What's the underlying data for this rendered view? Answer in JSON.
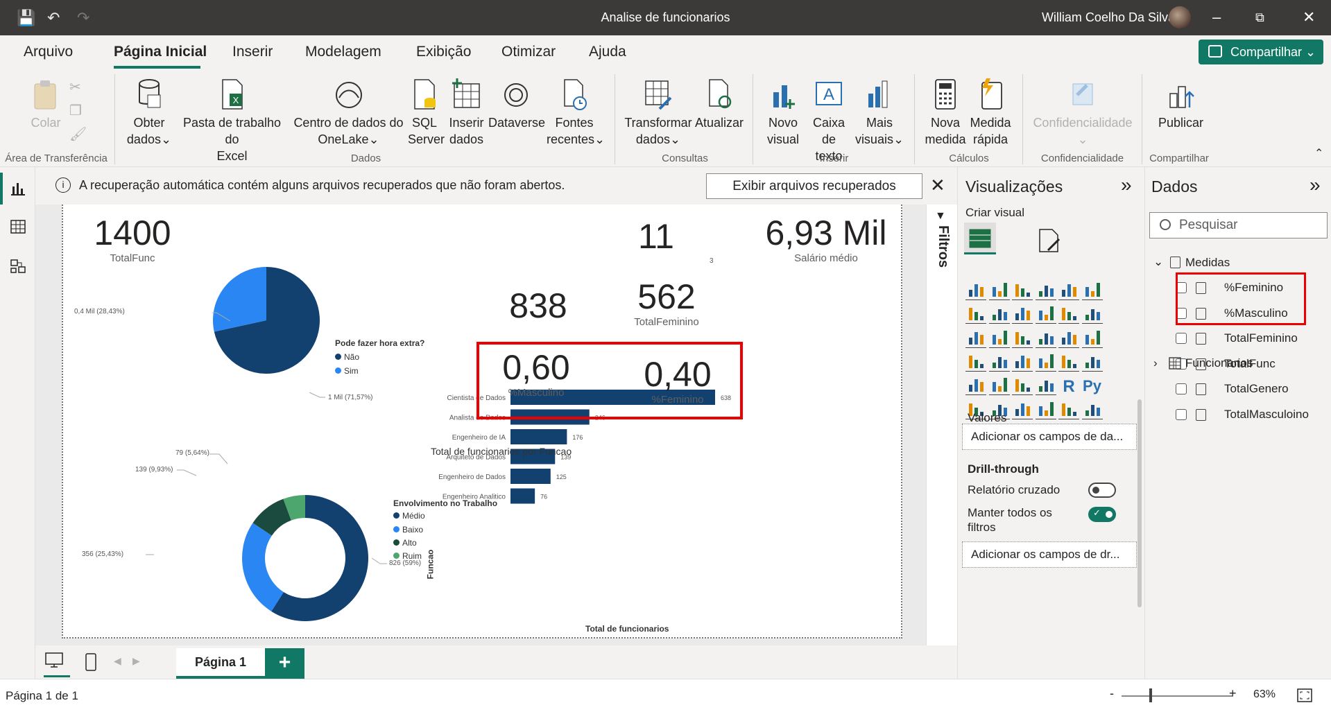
{
  "window": {
    "title": "Analise de funcionarios",
    "user": "William Coelho Da Silva"
  },
  "menu": {
    "tabs": [
      "Arquivo",
      "Página Inicial",
      "Inserir",
      "Modelagem",
      "Exibição",
      "Otimizar",
      "Ajuda"
    ],
    "share": "Compartilhar"
  },
  "ribbon": {
    "colar": "Colar",
    "obter": "Obter",
    "obter2": "dados",
    "pasta": "Pasta de trabalho do",
    "pasta2": "Excel",
    "centro": "Centro de dados do",
    "centro2": "OneLake",
    "sql": "SQL",
    "sql2": "Server",
    "inserir": "Inserir",
    "inserir2": "dados",
    "dataverse": "Dataverse",
    "fontes": "Fontes",
    "fontes2": "recentes",
    "transf": "Transformar",
    "transf2": "dados",
    "atualizar": "Atualizar",
    "novo": "Novo",
    "novo2": "visual",
    "caixa": "Caixa de",
    "caixa2": "texto",
    "mais": "Mais",
    "mais2": "visuais",
    "nova": "Nova",
    "nova2": "medida",
    "medida": "Medida",
    "medida2": "rápida",
    "conf": "Confidencialidade",
    "publicar": "Publicar",
    "groups": {
      "area": "Área de Transferência",
      "dados": "Dados",
      "consultas": "Consultas",
      "inserir": "Inserir",
      "calculos": "Cálculos",
      "conf": "Confidencialidade",
      "compartilhar": "Compartilhar"
    }
  },
  "notification": {
    "text": "A recuperação automática contém alguns arquivos recuperados que não foram abertos.",
    "button": "Exibir arquivos recuperados"
  },
  "report": {
    "kpis": {
      "total_func": "1400",
      "total_func_label": "TotalFunc",
      "k11": "11",
      "k11_sub": "3",
      "salario": "6,93 Mil",
      "salario_label": "Salário médio",
      "k838": "838",
      "k562": "562",
      "k562_label": "TotalFeminino",
      "masc": "0,60",
      "masc_label": "%Masculino",
      "fem": "0,40",
      "fem_label": "%Feminino"
    },
    "pie1": {
      "legend_title": "Pode fazer hora extra?",
      "items": [
        "Não",
        "Sim"
      ],
      "colors": [
        "#12406f",
        "#2a86f2"
      ],
      "labels": [
        "0,4 Mil (28,43%)",
        "1 Mil (71,57%)"
      ]
    },
    "donut": {
      "legend_title": "Envolvimento no Trabalho",
      "items": [
        "Médio",
        "Baixo",
        "Alto",
        "Ruim"
      ],
      "colors": [
        "#12406f",
        "#2a86f2",
        "#1b4b3e",
        "#4ea66f"
      ],
      "labels": [
        "79 (5,64%)",
        "139 (9,93%)",
        "356 (25,43%)",
        "826 (59%)"
      ]
    },
    "bar_title": "Total de funcionarios por Funcao",
    "bar_xlabel": "Total de funcionarios",
    "bar_ylabel": "Funcao"
  },
  "chart_data": [
    {
      "type": "pie",
      "title": "",
      "categories": [
        "Não",
        "Sim"
      ],
      "values": [
        1002,
        398
      ],
      "legend_title": "Pode fazer hora extra?"
    },
    {
      "type": "pie",
      "title": "",
      "subtype": "donut",
      "categories": [
        "Médio",
        "Baixo",
        "Alto",
        "Ruim"
      ],
      "values": [
        826,
        356,
        139,
        79
      ],
      "legend_title": "Envolvimento no Trabalho"
    },
    {
      "type": "bar",
      "title": "Total de funcionarios por Funcao",
      "orientation": "horizontal",
      "categories": [
        "Cientista de Dados",
        "Analista de Dados",
        "Engenheiro de IA",
        "Arquiteto de Dados",
        "Engenheiro de Dados",
        "Engenheiro Analitico"
      ],
      "values": [
        638,
        246,
        176,
        139,
        125,
        76
      ],
      "xlabel": "Total de funcionarios",
      "ylabel": "Funcao",
      "xlim": [
        0,
        638
      ]
    }
  ],
  "filters": {
    "label": "Filtros"
  },
  "pages": {
    "tab": "Página 1"
  },
  "viz": {
    "title": "Visualizações",
    "criar": "Criar visual",
    "valores": "Valores",
    "valores_well": "Adicionar os campos de da...",
    "drill": "Drill-through",
    "relatorio": "Relatório cruzado",
    "manter": "Manter todos os",
    "manter2": "filtros",
    "drill_well": "Adicionar os campos de dr..."
  },
  "dados": {
    "title": "Dados",
    "search": "Pesquisar",
    "medidas": "Medidas",
    "fields": [
      "%Feminino",
      "%Masculino",
      "TotalFeminino",
      "TotalFunc",
      "TotalGenero",
      "TotalMasculoino"
    ],
    "funcionarios": "Funcionarios"
  },
  "status": {
    "page": "Página 1 de 1",
    "zoom": "63%"
  }
}
